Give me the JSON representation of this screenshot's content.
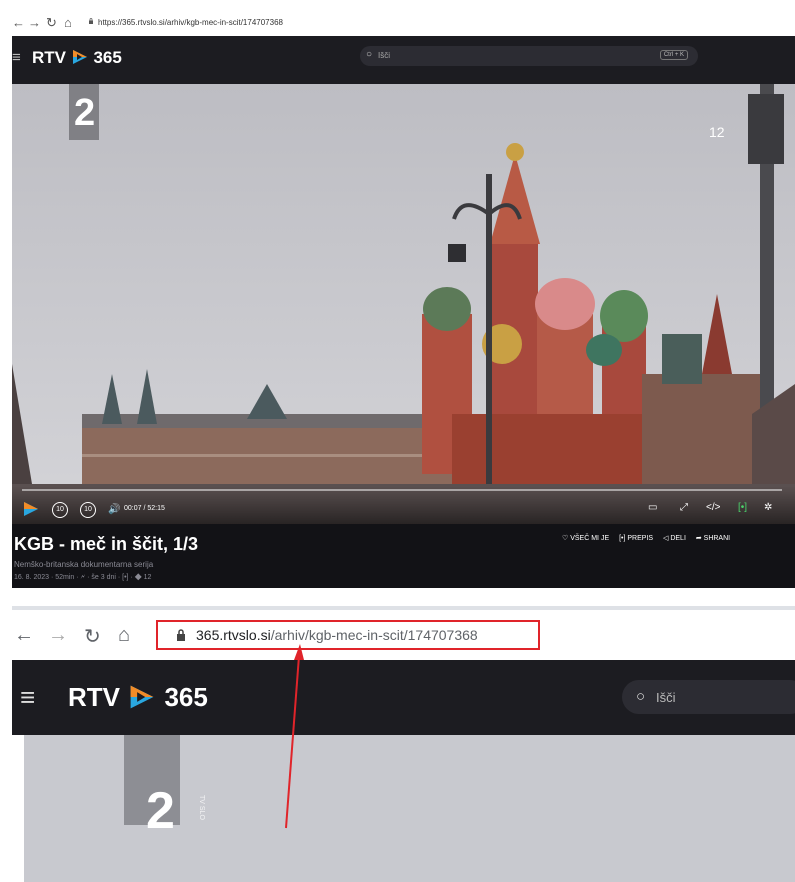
{
  "top": {
    "url": "https://365.rtvslo.si/arhiv/kgb-mec-in-scit/174707368",
    "logo_text": "RTV",
    "logo_num": "365",
    "search_placeholder": "Išči",
    "search_shortcut": "Ctrl + K",
    "channel_digit": "2",
    "age_rating": "12",
    "player": {
      "rewind": "10",
      "forward": "10",
      "time": "00:07 / 52:15"
    },
    "title": "KGB - meč in ščit, 1/3",
    "subtitle": "Nemško-britanska dokumentarna serija",
    "meta": "16. 8. 2023 · 52min · 🗲 · še 3 dni · [•] · ◆ 12",
    "actions": [
      "♡ VŠEČ MI JE",
      "[•] PREPIS",
      "◁ DELI",
      "➦ SHRANI"
    ]
  },
  "bottom": {
    "url_host": "365.rtvslo.si",
    "url_path": "/arhiv/kgb-mec-in-scit/174707368",
    "logo_text": "RTV",
    "logo_num": "365",
    "search_placeholder": "Išči",
    "channel_digit": "2",
    "channel_side": "TV SLO"
  },
  "colors": {
    "highlight": "#e0242a",
    "header_bg": "#1c1c21",
    "logo_orange": "#f28c28",
    "logo_blue": "#2aa7e0"
  }
}
